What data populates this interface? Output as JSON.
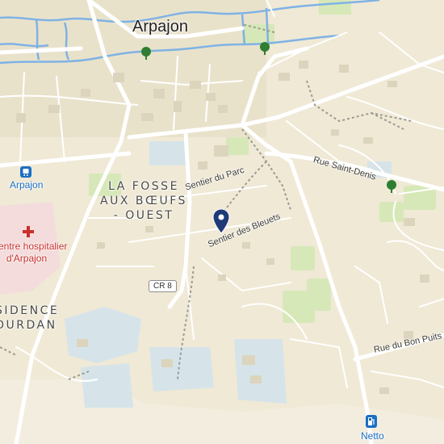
{
  "map": {
    "city_label": "Arpajon",
    "district_label_lines": [
      "LA FOSSE",
      "AUX BŒUFS",
      "- OUEST"
    ],
    "residence_label_lines": [
      "SIDENCE",
      "OURDAN"
    ],
    "streets": {
      "sentier_du_parc": "Sentier du Parc",
      "sentier_des_bleuets": "Sentier des Bleuets",
      "rue_saint_denis": "Rue Saint-Denis",
      "rue_du_bon_puits": "Rue du Bon Puits"
    },
    "road_badge": "CR 8",
    "pois": {
      "station": "Arpajon",
      "hospital_lines": [
        "entre hospitalier",
        "d'Arpajon"
      ],
      "fuel": "Netto"
    },
    "icons": {
      "pin": "location-pin-icon",
      "train": "train-station-icon",
      "hospital": "hospital-cross-icon",
      "fuel": "fuel-station-icon",
      "park": "park-tree-icon"
    },
    "colors": {
      "land": "#efe9d6",
      "water": "#7fb2e5",
      "green": "#d7e8b8",
      "institution": "#d6e4ea",
      "hospital_area": "#f4dcdc",
      "pin": "#1f3b77",
      "hospital": "#c8302c",
      "poi_blue": "#1a6fc4"
    }
  }
}
